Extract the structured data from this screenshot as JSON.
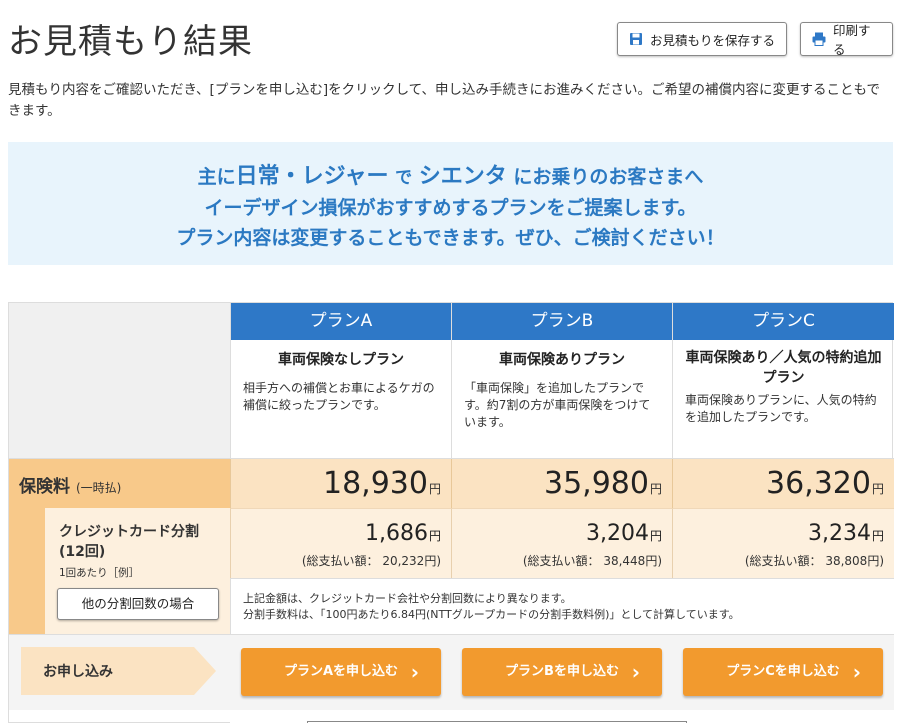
{
  "header": {
    "title": "お見積もり結果",
    "save_label": "お見積もりを保存する",
    "print_label": "印刷する"
  },
  "intro": {
    "text": "見積もり内容をご確認いただき、[プランを申し込む]をクリックして、申し込み手続きにお進みください。ご希望の補償内容に変更することもできます。"
  },
  "banner": {
    "line1_prefix": "主に",
    "usage": "日常・レジャー",
    "line1_mid": "で",
    "car": "シエンタ",
    "line1_suffix": "にお乗りのお客さまへ",
    "line2": "イーデザイン損保がおすすめするプランをご提案します。",
    "line3": "プラン内容は変更することもできます。ぜひ、ご検討ください！"
  },
  "plans": [
    {
      "label": "プランA",
      "name": "車両保険なしプラン",
      "description": "相手方への補償とお車によるケガの補償に絞ったプランです。",
      "premium": "18,930",
      "installment": "1,686",
      "installment_total": "(総支払い額： 20,232円)",
      "apply_label": "プランAを申し込む"
    },
    {
      "label": "プランB",
      "name": "車両保険ありプラン",
      "description": "「車両保険」を追加したプランです。約7割の方が車両保険をつけています。",
      "premium": "35,980",
      "installment": "3,204",
      "installment_total": "(総支払い額： 38,448円)",
      "apply_label": "プランBを申し込む"
    },
    {
      "label": "プランC",
      "name": "車両保険あり／人気の特約追加プラン",
      "description": "車両保険ありプランに、人気の特約を追加したプランです。",
      "premium": "36,320",
      "installment": "3,234",
      "installment_total": "(総支払い額： 38,808円)",
      "apply_label": "プランCを申し込む"
    }
  ],
  "rows": {
    "premium_label": "保険料",
    "premium_sub": "(一時払)",
    "yen": "円",
    "card_label": "クレジットカード分割(12回)",
    "card_sub": "1回あたり［例］",
    "other_installments_label": "他の分割回数の場合",
    "note1": "上記金額は、クレジットカード会社や分割回数により異なります。",
    "note2": "分割手数料は、「100円あたり6.84円(NTTグループカードの分割手数料例)」として計算しています。",
    "apply_row_label": "お申し込み"
  },
  "colors": {
    "plan_header": "#2e78c7",
    "banner_text": "#2b79c2",
    "premium_band": "#f8c98a",
    "apply_button": "#f29a2e"
  },
  "icons": {
    "save": "floppy-disk-icon",
    "print": "printer-icon",
    "chevron": "chevron-right-icon"
  }
}
